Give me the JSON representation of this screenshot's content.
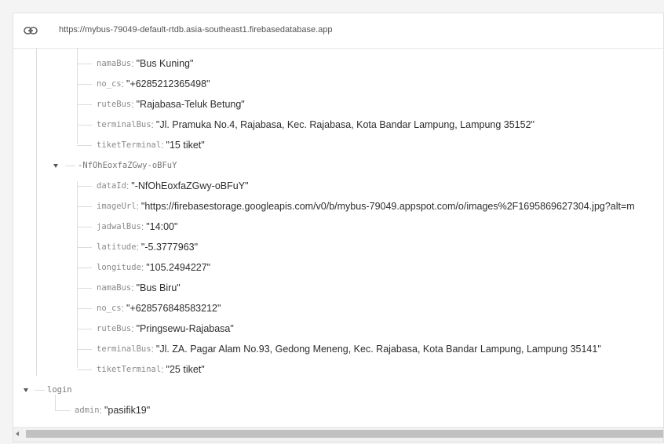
{
  "url_bar": {
    "url": "https://mybus-79049-default-rtdb.asia-southeast1.firebasedatabase.app"
  },
  "tree": {
    "record_a": {
      "namaBus": {
        "key": "namaBus",
        "value": "\"Bus Kuning\""
      },
      "no_cs": {
        "key": "no_cs",
        "value": "\"+6285212365498\""
      },
      "ruteBus": {
        "key": "ruteBus",
        "value": "\"Rajabasa-Teluk Betung\""
      },
      "terminalBus": {
        "key": "terminalBus",
        "value": "\"Jl. Pramuka No.4, Rajabasa, Kec. Rajabasa, Kota Bandar Lampung, Lampung 35152\""
      },
      "tiketTerminal": {
        "key": "tiketTerminal",
        "value": "\"15 tiket\""
      }
    },
    "record_b": {
      "key": "-NfOhEoxfaZGwy-oBFuY",
      "dataId": {
        "key": "dataId",
        "value": "\"-NfOhEoxfaZGwy-oBFuY\""
      },
      "imageUrl": {
        "key": "imageUrl",
        "value": "\"https://firebasestorage.googleapis.com/v0/b/mybus-79049.appspot.com/o/images%2F1695869627304.jpg?alt=m"
      },
      "jadwalBus": {
        "key": "jadwalBus",
        "value": "\"14:00\""
      },
      "latitude": {
        "key": "latitude",
        "value": "\"-5.3777963\""
      },
      "longitude": {
        "key": "longitude",
        "value": "\"105.2494227\""
      },
      "namaBus": {
        "key": "namaBus",
        "value": "\"Bus Biru\""
      },
      "no_cs": {
        "key": "no_cs",
        "value": "\"+628576848583212\""
      },
      "ruteBus": {
        "key": "ruteBus",
        "value": "\"Pringsewu-Rajabasa\""
      },
      "terminalBus": {
        "key": "terminalBus",
        "value": "\"Jl. ZA. Pagar Alam No.93, Gedong Meneng, Kec. Rajabasa, Kota Bandar Lampung, Lampung 35141\""
      },
      "tiketTerminal": {
        "key": "tiketTerminal",
        "value": "\"25 tiket\""
      }
    },
    "login": {
      "key": "login",
      "admin": {
        "key": "admin",
        "value": "\"pasifik19\""
      }
    }
  },
  "colors": {
    "key_text": "#8a8a8a",
    "value_text": "#2d2d2d",
    "tree_line": "#dcdcdc",
    "scroll_thumb": "#c1c1c1"
  }
}
